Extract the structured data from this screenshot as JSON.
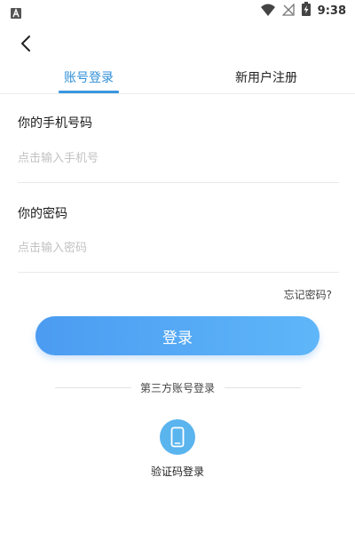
{
  "status_bar": {
    "time": "9:38",
    "left_icon": "a-badge-icon",
    "icons": [
      "wifi-icon",
      "no-signal-icon",
      "battery-charging-icon"
    ]
  },
  "header": {
    "back_icon": "chevron-left-icon"
  },
  "tabs": [
    {
      "label": "账号登录",
      "active": true
    },
    {
      "label": "新用户注册",
      "active": false
    }
  ],
  "form": {
    "phone": {
      "label": "你的手机号码",
      "placeholder": "点击输入手机号",
      "value": ""
    },
    "password": {
      "label": "你的密码",
      "placeholder": "点击输入密码",
      "value": ""
    },
    "forgot_label": "忘记密码?",
    "submit_label": "登录"
  },
  "third_party": {
    "title": "第三方账号登录",
    "options": [
      {
        "label": "验证码登录",
        "icon": "phone-icon"
      }
    ]
  },
  "colors": {
    "accent": "#3a97e0",
    "button_gradient_start": "#4b9cf2",
    "button_gradient_end": "#5fb6f8",
    "sms_circle": "#5ab4ee"
  }
}
